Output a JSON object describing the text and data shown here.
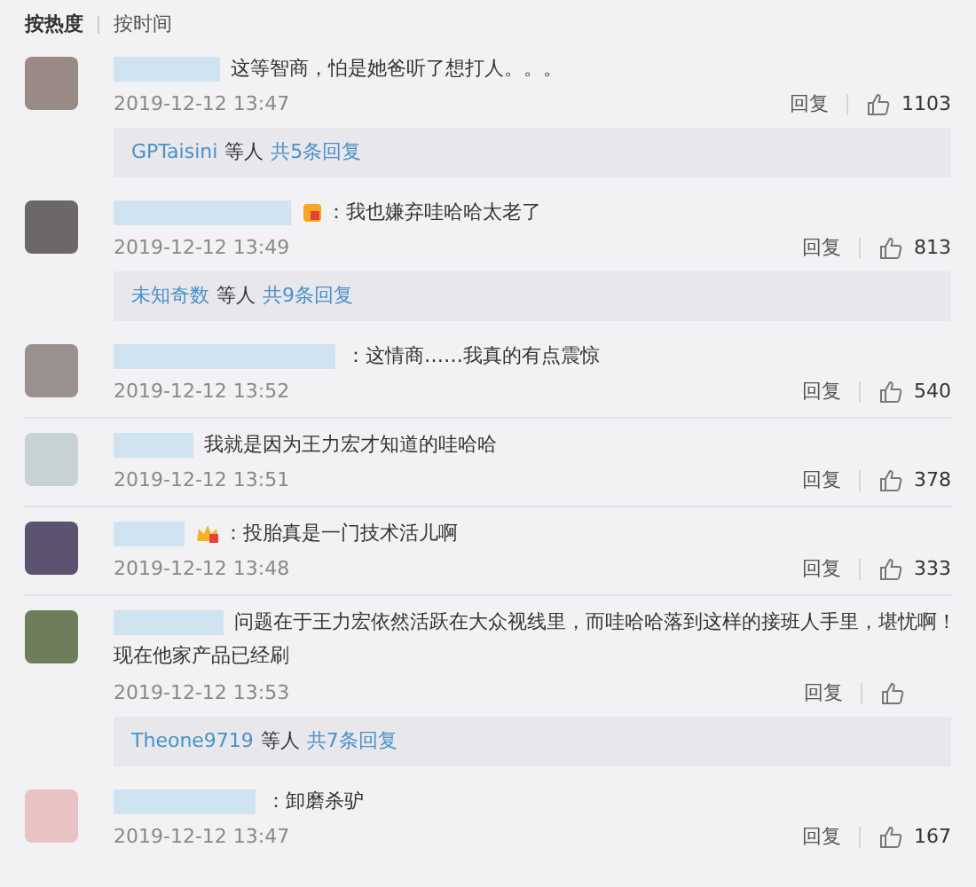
{
  "sort_tabs": [
    {
      "label": "按热度",
      "selected": true
    },
    {
      "label": "按时间",
      "selected": false
    }
  ],
  "comments": [
    {
      "text": "这等智商，怕是她爸听了想打人。。。",
      "date": "2019-12-12 13:47",
      "reply_label": "回复",
      "likes": "1103",
      "replies": {
        "user": "GPTaisini",
        "suffix": "等人",
        "count": "共5条回复"
      }
    },
    {
      "text": "：我也嫌弃哇哈哈太老了",
      "badge": {
        "kind": "vip"
      },
      "date": "2019-12-12 13:49",
      "reply_label": "回复",
      "likes": "813",
      "replies": {
        "user": "未知奇数",
        "suffix": "等人",
        "count": "共9条回复"
      }
    },
    {
      "text": "：这情商……我真的有点震惊",
      "date": "2019-12-12 13:52",
      "reply_label": "回复",
      "likes": "540"
    },
    {
      "text": "我就是因为王力宏才知道的哇哈哈",
      "date": "2019-12-12 13:51",
      "reply_label": "回复",
      "likes": "378"
    },
    {
      "text": "：投胎真是一门技术活儿啊",
      "badge": {
        "kind": "crown"
      },
      "date": "2019-12-12 13:48",
      "reply_label": "回复",
      "likes": "333"
    },
    {
      "text": "问题在于王力宏依然活跃在大众视线里，而哇哈哈落到这样的接班人手里，堪忧啊！",
      "text_line_2": "现在他家产品已经刷",
      "date": "2019-12-12 13:53",
      "reply_label": "回复",
      "replies": {
        "user": "Theone9719",
        "suffix": "等人",
        "count": "共7条回复"
      }
    },
    {
      "text": "：卸磨杀驴",
      "date": "2019-12-12 13:47",
      "reply_label": "回复",
      "likes": "167"
    }
  ]
}
